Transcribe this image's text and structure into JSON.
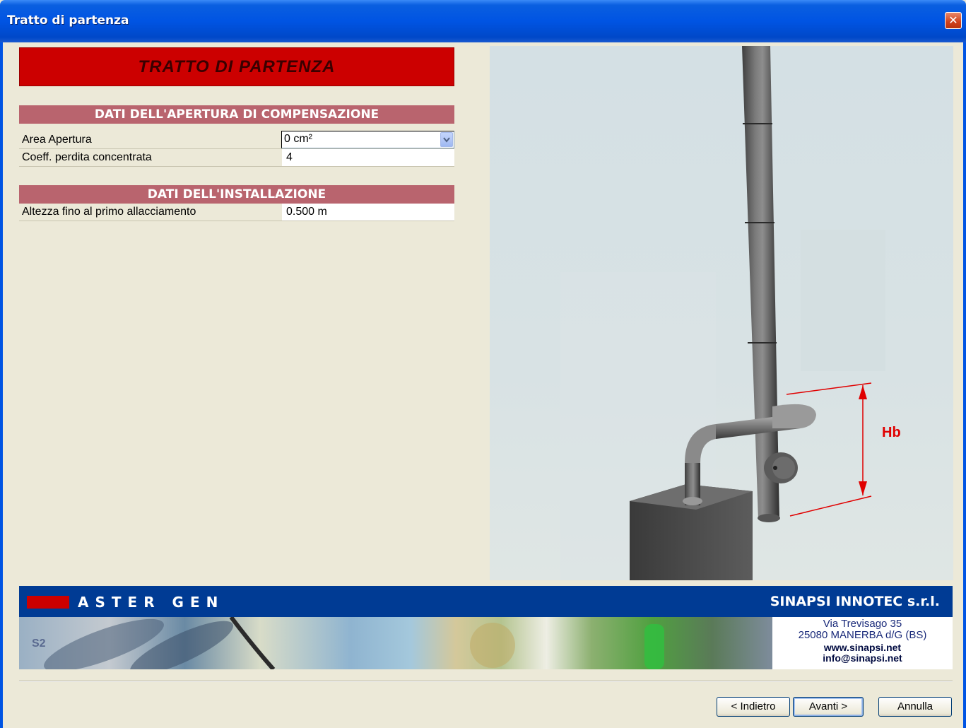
{
  "window": {
    "title": "Tratto di partenza",
    "close_glyph": "✕"
  },
  "banner": {
    "title": "TRATTO DI PARTENZA"
  },
  "section_compensation": {
    "header": "DATI DELL'APERTURA DI COMPENSAZIONE",
    "rows": [
      {
        "label": "Area Apertura",
        "value": "0 cm²"
      },
      {
        "label": "Coeff. perdita concentrata",
        "value": "4"
      }
    ]
  },
  "section_installation": {
    "header": "DATI DELL'INSTALLAZIONE",
    "rows": [
      {
        "label": "Altezza fino al primo allacciamento",
        "value": "0.500 m"
      }
    ]
  },
  "diagram": {
    "dimension_label": "Hb"
  },
  "footer": {
    "product": "ASTER GEN",
    "company": "SINAPSI INNOTEC s.r.l.",
    "address_street": "Via Trevisago 35",
    "address_city": "25080 MANERBA d/G (BS)",
    "website": "www.sinapsi.net",
    "email": "info@sinapsi.net",
    "collage_text": "S2"
  },
  "buttons": {
    "back": "< Indietro",
    "next": "Avanti >",
    "cancel": "Annulla"
  },
  "colors": {
    "title_bar": "#0054e3",
    "banner_red": "#cc0000",
    "section_header": "#b9646e",
    "footer_blue": "#003b94"
  }
}
